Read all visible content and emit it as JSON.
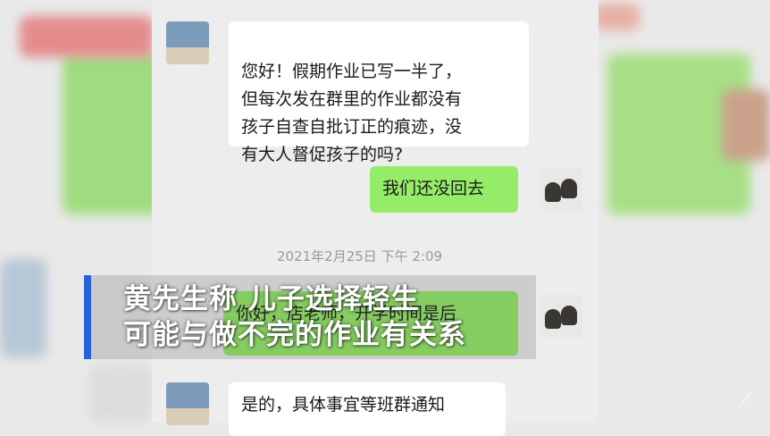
{
  "messages": [
    {
      "side": "left",
      "text": "您好！假期作业已写一半了，\n但每次发在群里的作业都没有\n孩子自查自批订正的痕迹，没\n有大人督促孩子的吗?"
    },
    {
      "side": "right",
      "text": "我们还没回去"
    },
    {
      "side": "right",
      "text": "你好，店老师，开学时间是后"
    },
    {
      "side": "left",
      "text": "是的，具体事宜等班群通知"
    }
  ],
  "timestamp": "2021年2月25日 下午 2:09",
  "caption": {
    "line1": "黄先生称 儿子选择轻生",
    "line2": "可能与做不完的作业有关系"
  },
  "colors": {
    "caption_bar": "#2563d9",
    "right_bubble": "#95ec69",
    "left_bubble": "#ffffff"
  },
  "icons": {
    "watermark": "slash-watermark-icon"
  }
}
